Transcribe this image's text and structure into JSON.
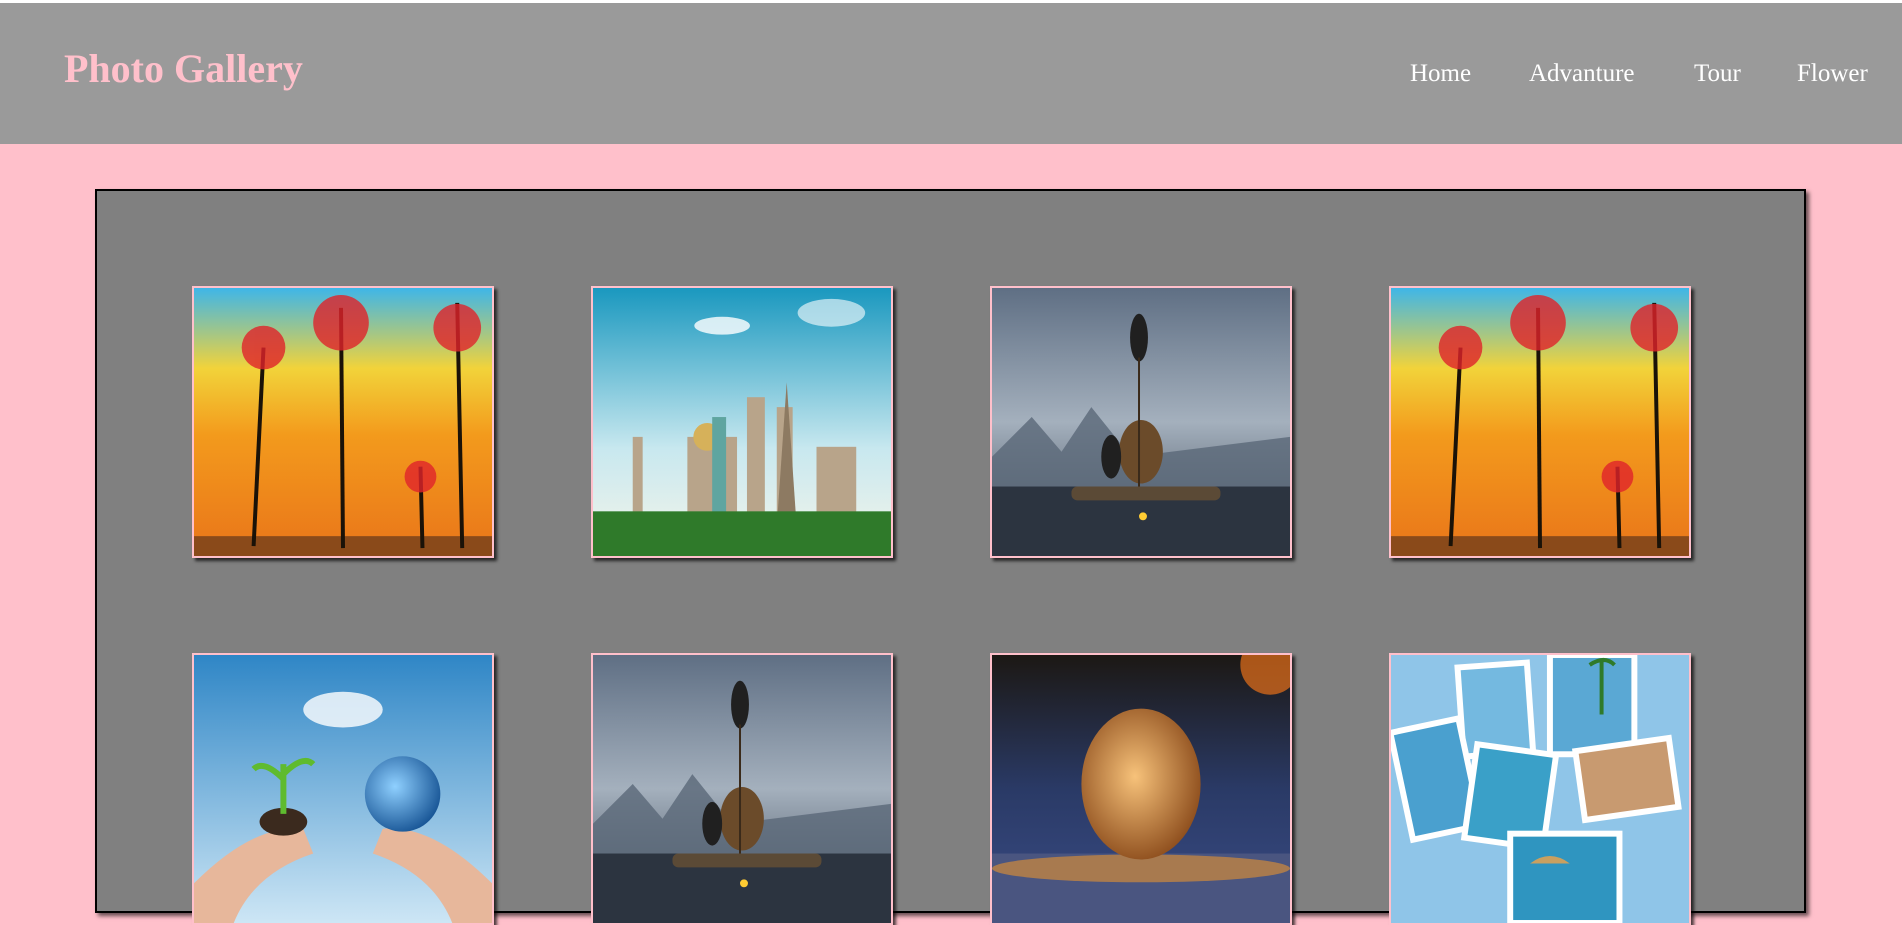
{
  "header": {
    "title": "Photo Gallery",
    "nav": [
      "Home",
      "Advanture",
      "Tour",
      "Flower"
    ]
  },
  "colors": {
    "page_bg": "#ffc0cb",
    "header_bg": "#9a9a9a",
    "title": "#ffc0cb",
    "nav_text": "#ffffff",
    "panel_bg": "#808080",
    "thumb_border": "#ffc0cb"
  },
  "gallery": {
    "images": [
      {
        "subject": "autumn-trees-painting"
      },
      {
        "subject": "world-landmarks"
      },
      {
        "subject": "fisherman-cormorant-raft"
      },
      {
        "subject": "autumn-trees-painting"
      },
      {
        "subject": "hands-holding-plant-and-earth"
      },
      {
        "subject": "fisherman-cormorant-raft"
      },
      {
        "subject": "frozen-bubble-sunset"
      },
      {
        "subject": "beach-photo-collage"
      }
    ]
  }
}
